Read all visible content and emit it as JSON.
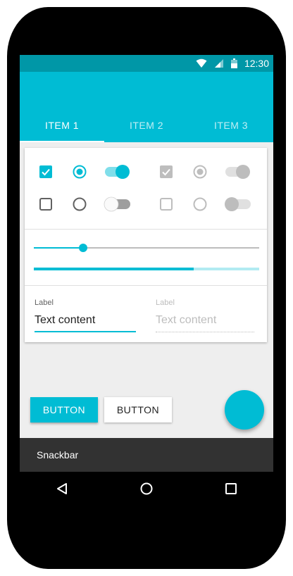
{
  "status_bar": {
    "time": "12:30",
    "icons": [
      "wifi-icon",
      "cell-signal-icon",
      "battery-icon"
    ]
  },
  "tabs": [
    {
      "label": "ITEM 1",
      "selected": true
    },
    {
      "label": "ITEM 2",
      "selected": false
    },
    {
      "label": "ITEM 3",
      "selected": false
    }
  ],
  "controls": {
    "enabled": {
      "checkbox_checked": true,
      "radio_checked": true,
      "switch_on": true,
      "checkbox_unchecked": false,
      "radio_unchecked": false,
      "switch_off": false
    },
    "disabled": {
      "checkbox_checked": true,
      "radio_checked": true,
      "switch_on": true,
      "checkbox_unchecked": false,
      "radio_unchecked": false,
      "switch_off": false
    }
  },
  "slider": {
    "value": 0.22
  },
  "progress": {
    "value": 0.71,
    "buffer": 1.0
  },
  "fields": {
    "enabled": {
      "label": "Label",
      "value": "Text content"
    },
    "disabled": {
      "label": "Label",
      "value": "Text content"
    }
  },
  "buttons": {
    "raised_label": "BUTTON",
    "flat_label": "BUTTON"
  },
  "fab": {
    "icon": "none"
  },
  "snackbar": {
    "text": "Snackbar"
  },
  "nav": {
    "icons": [
      "back-icon",
      "home-icon",
      "recents-icon"
    ]
  },
  "colors": {
    "primary": "#00bcd4",
    "primary_dark": "#0097a7",
    "background": "#eeeeee",
    "snackbar": "#323232",
    "disabled": "#bdbdbd"
  }
}
